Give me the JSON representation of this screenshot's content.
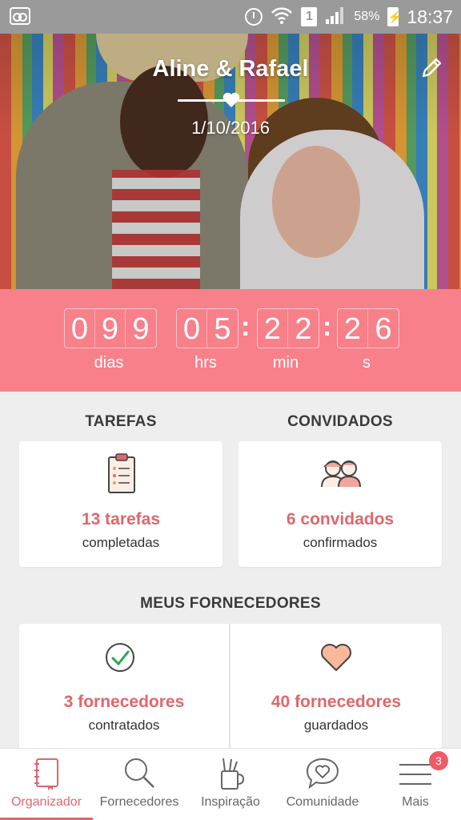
{
  "status_bar": {
    "battery_percent": "58%",
    "time": "18:37",
    "sim_slot": "1"
  },
  "hero": {
    "couple_name": "Aline & Rafael",
    "date": "1/10/2016"
  },
  "countdown": {
    "days": [
      "0",
      "9",
      "9"
    ],
    "hours": [
      "0",
      "5"
    ],
    "minutes": [
      "2",
      "2"
    ],
    "seconds": [
      "2",
      "6"
    ],
    "labels": {
      "days": "dias",
      "hours": "hrs",
      "minutes": "min",
      "seconds": "s"
    }
  },
  "tasks": {
    "title": "TAREFAS",
    "count": "13 tarefas",
    "sub": "completadas"
  },
  "guests": {
    "title": "CONVIDADOS",
    "count": "6 convidados",
    "sub": "confirmados"
  },
  "vendors": {
    "title": "MEUS FORNECEDORES",
    "hired": {
      "count": "3 fornecedores",
      "sub": "contratados"
    },
    "saved": {
      "count": "40 fornecedores",
      "sub": "guardados"
    }
  },
  "nav": {
    "items": [
      {
        "label": "Organizador",
        "icon": "notebook-icon"
      },
      {
        "label": "Fornecedores",
        "icon": "search-icon"
      },
      {
        "label": "Inspiração",
        "icon": "cup-icon"
      },
      {
        "label": "Comunidade",
        "icon": "chat-heart-icon"
      },
      {
        "label": "Mais",
        "icon": "menu-icon"
      }
    ],
    "badge": "3"
  },
  "colors": {
    "accent": "#f7808a",
    "text_accent": "#e0666b",
    "status_bar": "#9a9a9a"
  }
}
